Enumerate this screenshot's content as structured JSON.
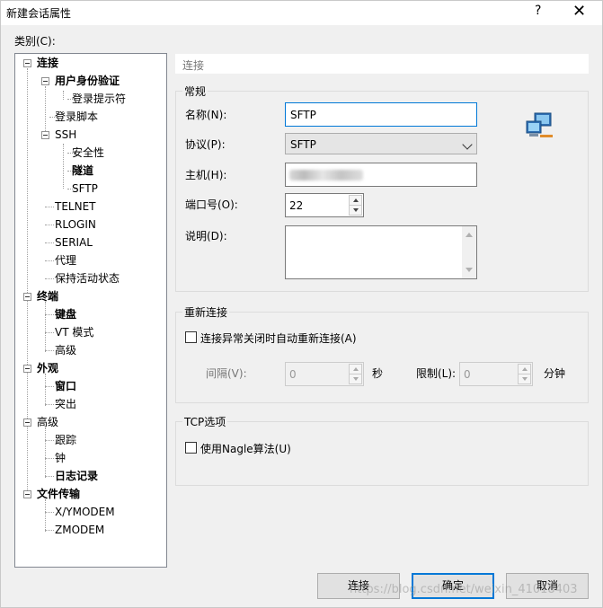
{
  "window": {
    "title": "新建会话属性",
    "help": "?",
    "close": "✕"
  },
  "category_label": "类别(C):",
  "tree": [
    {
      "label": "连接",
      "bold": true
    },
    {
      "label": "用户身份验证",
      "bold": true
    },
    {
      "label": "登录提示符",
      "bold": false
    },
    {
      "label": "登录脚本",
      "bold": false
    },
    {
      "label": "SSH",
      "bold": false
    },
    {
      "label": "安全性",
      "bold": false
    },
    {
      "label": "隧道",
      "bold": true
    },
    {
      "label": "SFTP",
      "bold": false
    },
    {
      "label": "TELNET",
      "bold": false
    },
    {
      "label": "RLOGIN",
      "bold": false
    },
    {
      "label": "SERIAL",
      "bold": false
    },
    {
      "label": "代理",
      "bold": false
    },
    {
      "label": "保持活动状态",
      "bold": false
    },
    {
      "label": "终端",
      "bold": true
    },
    {
      "label": "键盘",
      "bold": true
    },
    {
      "label": "VT 模式",
      "bold": false
    },
    {
      "label": "高级",
      "bold": false
    },
    {
      "label": "外观",
      "bold": true
    },
    {
      "label": "窗口",
      "bold": true
    },
    {
      "label": "突出",
      "bold": false
    },
    {
      "label": "高级",
      "bold": false
    },
    {
      "label": "跟踪",
      "bold": false
    },
    {
      "label": "钟",
      "bold": false
    },
    {
      "label": "日志记录",
      "bold": true
    },
    {
      "label": "文件传输",
      "bold": true
    },
    {
      "label": "X/YMODEM",
      "bold": false
    },
    {
      "label": "ZMODEM",
      "bold": false
    }
  ],
  "section_heading": "连接",
  "general": {
    "title": "常规",
    "name_label": "名称(N):",
    "name_value": "SFTP",
    "protocol_label": "协议(P):",
    "protocol_value": "SFTP",
    "host_label": "主机(H):",
    "host_value": "",
    "port_label": "端口号(O):",
    "port_value": "22",
    "desc_label": "说明(D):",
    "desc_value": ""
  },
  "reconnect": {
    "title": "重新连接",
    "checkbox_label": "连接异常关闭时自动重新连接(A)",
    "interval_label": "间隔(V):",
    "interval_value": "0",
    "interval_unit": "秒",
    "limit_label": "限制(L):",
    "limit_value": "0",
    "limit_unit": "分钟"
  },
  "tcp": {
    "title": "TCP选项",
    "nagle_label": "使用Nagle算法(U)"
  },
  "buttons": {
    "connect": "连接",
    "ok": "确定",
    "cancel": "取消"
  },
  "watermark": "https://blog.csdn.net/weixin_41018403",
  "icons": {
    "session": "network-computers-icon"
  },
  "colors": {
    "accent": "#0078d7"
  }
}
